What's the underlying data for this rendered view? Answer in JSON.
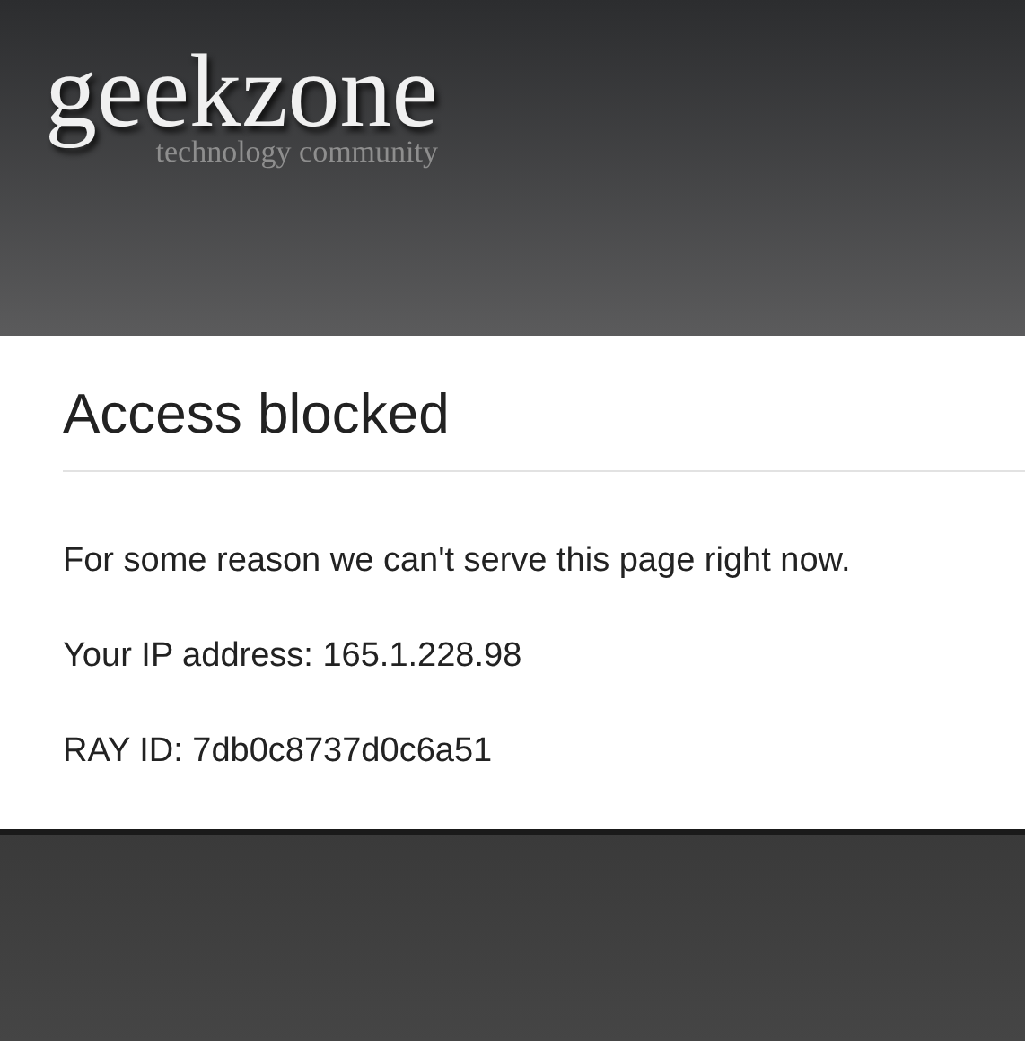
{
  "header": {
    "logo": "geekzone",
    "tagline": "technology community"
  },
  "content": {
    "title": "Access blocked",
    "paragraphs": [
      "For some reason we can't serve this page right now.",
      "Your IP address: 165.1.228.98",
      "RAY ID: 7db0c8737d0c6a51"
    ]
  }
}
